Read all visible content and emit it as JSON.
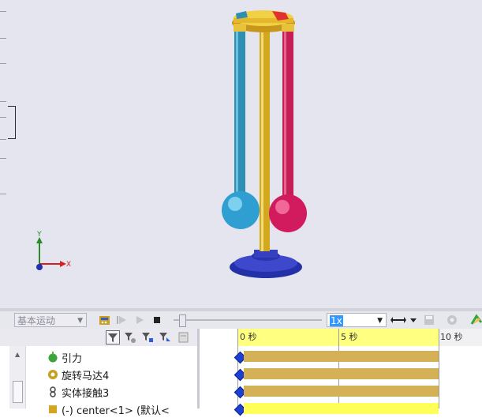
{
  "viewport": {
    "background": "#e4e5ee",
    "axes": {
      "x_label": "X",
      "y_label": "Y",
      "x_color": "#d42020",
      "y_color": "#2a8a2a",
      "z_color": "#2030b0"
    }
  },
  "motion_toolbar": {
    "study_type": "基本运动",
    "speed": "1x",
    "icons": [
      "calculate-icon",
      "play-from-start-icon",
      "play-icon",
      "stop-icon",
      "playback-mode-icon",
      "save-animation-icon",
      "study-properties-icon",
      "results-plots-icon"
    ]
  },
  "tree_filter_icons": [
    "filter-animating-icon",
    "filter-driving-icon",
    "filter-selected-icon",
    "filter-results-icon",
    "filter-auto-key-icon"
  ],
  "tree": {
    "items": [
      {
        "label": "引力",
        "icon": "gravity-icon",
        "color": "#3da43d"
      },
      {
        "label": "旋转马达4",
        "icon": "rotary-motor-icon",
        "color": "#c8a020"
      },
      {
        "label": "实体接触3",
        "icon": "contact-icon",
        "color": "#444444"
      },
      {
        "label": "(-) center<1> (默认<",
        "icon": "part-icon",
        "color": "#d6a520"
      }
    ]
  },
  "timeline": {
    "ticks": [
      {
        "label": "0 秒"
      },
      {
        "label": "5 秒"
      },
      {
        "label": "10 秒"
      }
    ],
    "bar_color": "#d4b057",
    "ruler_color": "#ffff80"
  }
}
